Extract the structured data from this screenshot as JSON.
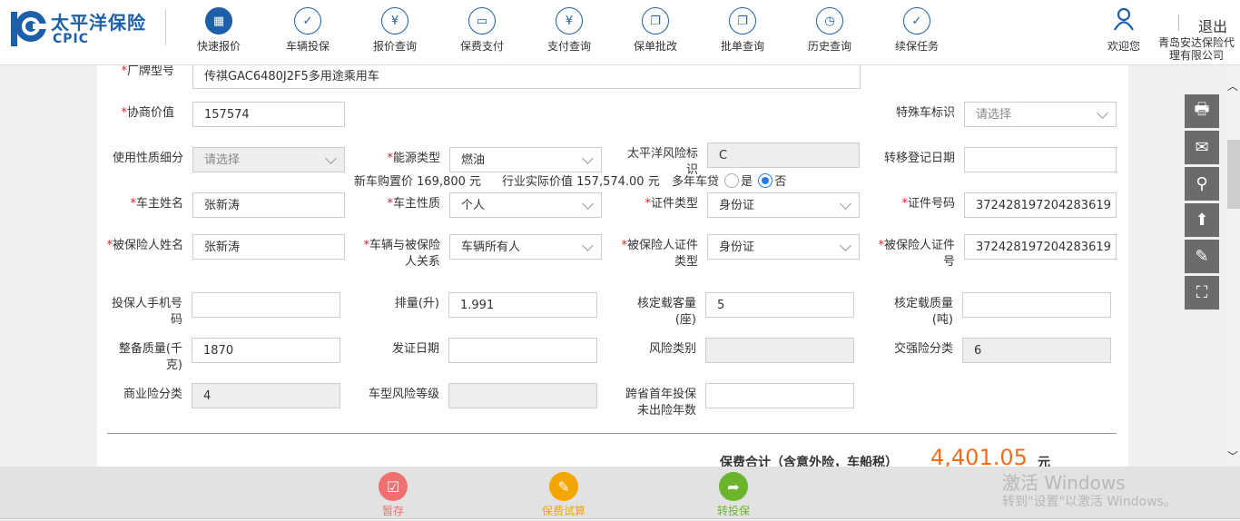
{
  "header": {
    "logo_cn": "太平洋保险",
    "logo_en": "CPIC",
    "nav": [
      {
        "label": "快速报价",
        "icon": "calculator-icon",
        "active": true
      },
      {
        "label": "车辆投保",
        "icon": "document-check-icon"
      },
      {
        "label": "报价查询",
        "icon": "clipboard-yen-icon"
      },
      {
        "label": "保费支付",
        "icon": "card-icon"
      },
      {
        "label": "支付查询",
        "icon": "yen-search-icon"
      },
      {
        "label": "保单批改",
        "icon": "copy-check-icon"
      },
      {
        "label": "批单查询",
        "icon": "copy-search-icon"
      },
      {
        "label": "历史查询",
        "icon": "clock-icon"
      },
      {
        "label": "续保任务",
        "icon": "calendar-check-icon"
      }
    ],
    "welcome": "欢迎您",
    "company": "青岛安达保险代理有限公司",
    "logout": "退出"
  },
  "form": {
    "fields": [
      {
        "label": "厂牌型号",
        "required": true,
        "kind": "input",
        "value": "传祺GAC6480J2F5多用途乘用车"
      },
      {
        "label": "协商价值",
        "required": true,
        "kind": "input",
        "value": "157574"
      },
      {
        "label": "特殊车标识",
        "kind": "select",
        "value": "请选择"
      },
      {
        "label": "使用性质细分",
        "kind": "disabled-select",
        "value": "请选择"
      },
      {
        "label": "能源类型",
        "required": true,
        "kind": "select",
        "value": "燃油"
      },
      {
        "label": "太平洋风险标识",
        "kind": "disabled",
        "value": "C"
      },
      {
        "label": "转移登记日期",
        "kind": "input",
        "value": ""
      },
      {
        "label": "车主姓名",
        "required": true,
        "kind": "input",
        "value": "张新涛"
      },
      {
        "label": "车主性质",
        "required": true,
        "kind": "select",
        "value": "个人"
      },
      {
        "label": "证件类型",
        "required": true,
        "kind": "select",
        "value": "身份证"
      },
      {
        "label": "证件号码",
        "required": true,
        "kind": "input",
        "value": "372428197204283619"
      },
      {
        "label": "被保险人姓名",
        "required": true,
        "kind": "input",
        "value": "张新涛"
      },
      {
        "label": "车辆与被保险人关系",
        "required": true,
        "kind": "select",
        "value": "车辆所有人"
      },
      {
        "label": "被保险人证件类型",
        "required": true,
        "kind": "select",
        "value": "身份证"
      },
      {
        "label": "被保险人证件号",
        "required": true,
        "kind": "input",
        "value": "372428197204283619"
      },
      {
        "label": "投保人手机号码",
        "kind": "input",
        "value": ""
      },
      {
        "label": "排量(升)",
        "kind": "input",
        "value": "1.991"
      },
      {
        "label": "核定载客量(座)",
        "kind": "input",
        "value": "5"
      },
      {
        "label": "核定载质量(吨)",
        "kind": "input",
        "value": ""
      },
      {
        "label": "整备质量(千克)",
        "kind": "input",
        "value": "1870"
      },
      {
        "label": "发证日期",
        "kind": "input",
        "value": ""
      },
      {
        "label": "风险类别",
        "kind": "disabled",
        "value": ""
      },
      {
        "label": "交强险分类",
        "kind": "disabled",
        "value": "6"
      },
      {
        "label": "商业险分类",
        "kind": "disabled",
        "value": "4"
      },
      {
        "label": "车型风险等级",
        "kind": "disabled",
        "value": ""
      },
      {
        "label": "跨省首年投保未出险年数",
        "kind": "input",
        "value": ""
      }
    ],
    "new_car_price": "新车购置价 169,800 元",
    "actual_value": "行业实际价值 157,574.00 元",
    "loan_label": "多年车贷",
    "loan_yes": "是",
    "loan_no": "否",
    "loan_selected": "否"
  },
  "total": {
    "label": "保费合计（含意外险，车船税）",
    "value": "4,401.05",
    "unit": "元",
    "color": "#f26d1b"
  },
  "tools": [
    "printer-icon",
    "mail-upload-icon",
    "search-icon",
    "box-upload-icon",
    "edit-icon",
    "scan-icon"
  ],
  "actions": [
    {
      "label": "暂存",
      "icon": "checkbox-icon",
      "color": "#f07070"
    },
    {
      "label": "保费试算",
      "icon": "note-edit-icon",
      "color": "#f5a500"
    },
    {
      "label": "转投保",
      "icon": "forward-arrow-icon",
      "color": "#6cb42c"
    }
  ],
  "watermark": {
    "line1": "激活 Windows",
    "line2": "转到\"设置\"以激活 Windows。"
  }
}
